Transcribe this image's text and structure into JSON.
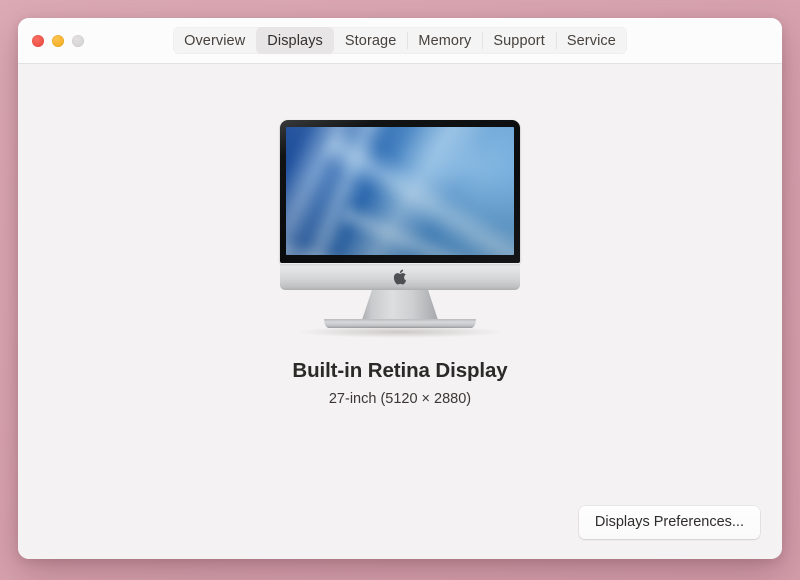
{
  "window": {
    "traffic_lights": [
      {
        "name": "close",
        "label": "Close",
        "color": "#ef5349"
      },
      {
        "name": "minimize",
        "label": "Minimize",
        "color": "#f5b32c"
      },
      {
        "name": "zoom",
        "label": "Zoom",
        "color": "#d8d6d6"
      }
    ],
    "tabs": [
      {
        "label": "Overview",
        "selected": false
      },
      {
        "label": "Displays",
        "selected": true
      },
      {
        "label": "Storage",
        "selected": false
      },
      {
        "label": "Memory",
        "selected": false
      },
      {
        "label": "Support",
        "selected": false
      },
      {
        "label": "Service",
        "selected": false
      }
    ]
  },
  "main": {
    "device_icon": "imac-icon",
    "apple_logo_icon": "apple-logo-icon",
    "display_name": "Built-in Retina Display",
    "display_spec": "27-inch (5120 × 2880)"
  },
  "footer": {
    "preferences_button": "Displays Preferences..."
  },
  "colors": {
    "desktop": "#dca8b3",
    "window_body": "#f4f2f2",
    "titlebar": "#fdfcfc",
    "tab_selected": "#e7e5e5",
    "screen_blue_dark": "#1b4a97",
    "screen_blue_light": "#6aa6d8"
  }
}
